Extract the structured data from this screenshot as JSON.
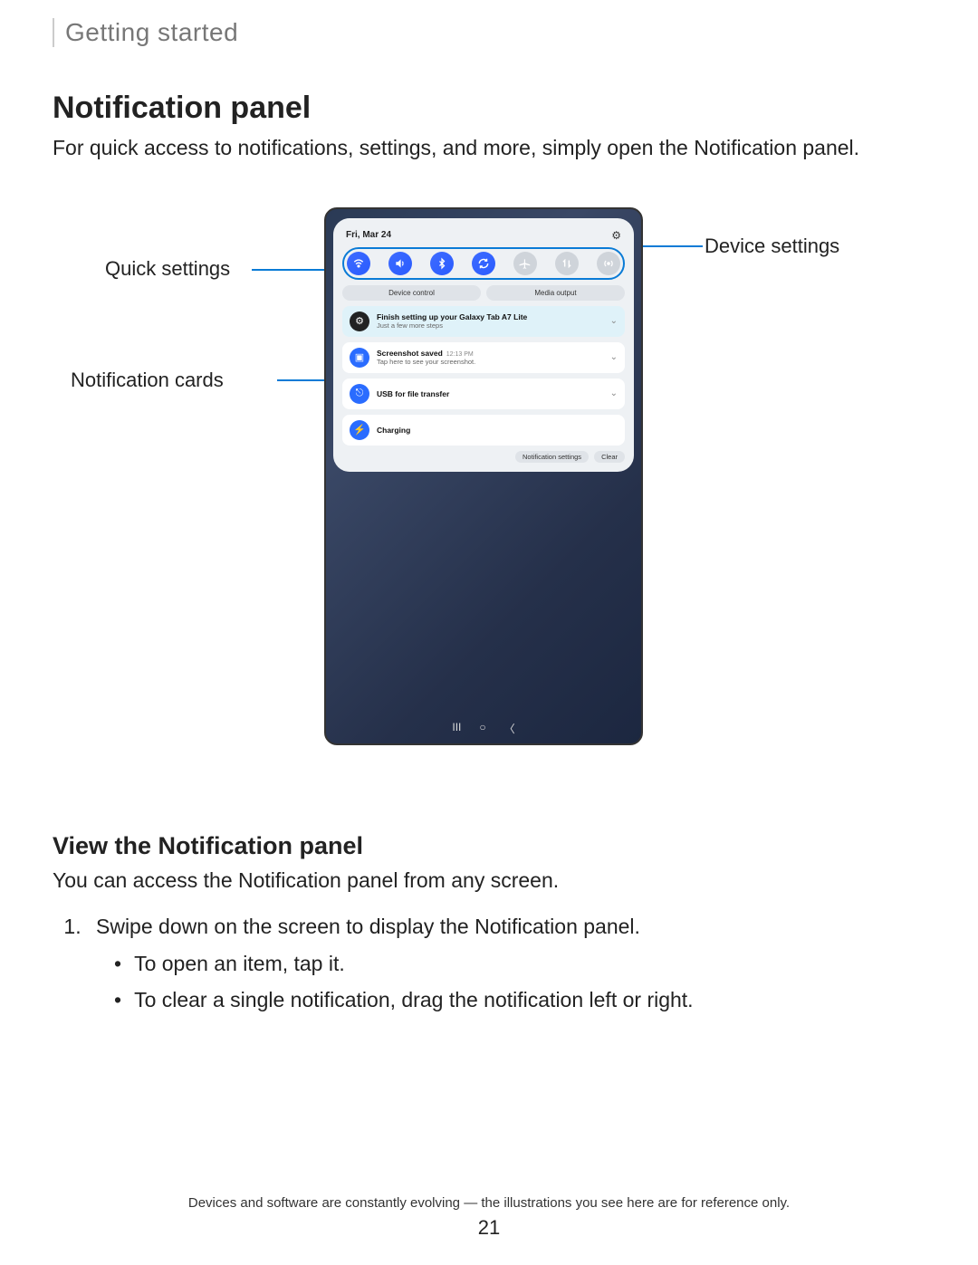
{
  "breadcrumb": "Getting started",
  "title": "Notification panel",
  "intro": "For quick access to notifications, settings, and more, simply open the Notification panel.",
  "callouts": {
    "quick_settings": "Quick settings",
    "notification_cards": "Notification cards",
    "device_settings": "Device settings"
  },
  "device": {
    "date": "Fri, Mar 24",
    "quick_settings_icons": [
      "wifi",
      "sound",
      "bluetooth",
      "rotate",
      "airplane",
      "data",
      "hotspot"
    ],
    "middle_buttons": {
      "left": "Device control",
      "right": "Media output"
    },
    "notifications": [
      {
        "icon": "gear",
        "title": "Finish setting up your Galaxy Tab A7 Lite",
        "sub": "Just a few more steps",
        "highlight": true
      },
      {
        "icon": "image",
        "title": "Screenshot saved",
        "time": "12:13 PM",
        "sub": "Tap here to see your screenshot."
      },
      {
        "icon": "usb",
        "title": "USB for file transfer"
      },
      {
        "icon": "bolt",
        "title": "Charging"
      }
    ],
    "panel_actions": {
      "settings": "Notification settings",
      "clear": "Clear"
    }
  },
  "subsection": {
    "title": "View the Notification panel",
    "intro": "You can access the Notification panel from any screen.",
    "step1": "Swipe down on the screen to display the Notification panel.",
    "bullets": [
      "To open an item, tap it.",
      "To clear a single notification, drag the notification left or right."
    ]
  },
  "footer": "Devices and software are constantly evolving — the illustrations you see here are for reference only.",
  "page_number": "21"
}
